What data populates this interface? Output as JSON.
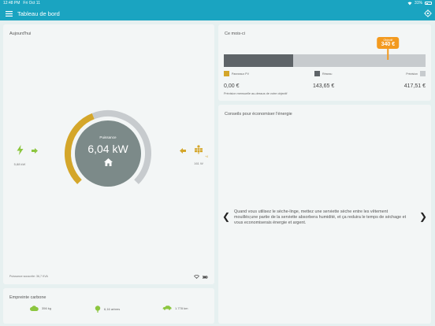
{
  "status_bar": {
    "time": "12:48 PM",
    "date": "Fri Oct 11",
    "battery": "31%",
    "battery_level": 0.31
  },
  "header": {
    "title": "Tableau de bord"
  },
  "today": {
    "title": "Aujourd'hui",
    "gauge_label": "Puissance",
    "gauge_value": "6,04 kW",
    "gauge_level": 0.42,
    "left_value": "5,88 kW",
    "right_value": "161 W",
    "right_badge": "+4",
    "footer": "Puissance souscrite: 36,7 KVA"
  },
  "month": {
    "title": "Ce mois-ci",
    "fill_fraction": 0.345,
    "objective_label": "Objectif",
    "objective_value": "340 €",
    "objective_fraction": 0.814,
    "legend": [
      {
        "label": "Panneaux PV",
        "color": "#d4a62a",
        "amount": "0,00 €"
      },
      {
        "label": "Réseau",
        "color": "#5e6468",
        "amount": "143,65 €"
      },
      {
        "label": "Prévision",
        "color": "#c7cbce",
        "amount": "417,51 €"
      }
    ],
    "note": "Prévision mensuelle au-dessus de votre objectif"
  },
  "tips": {
    "title": "Conseils pour économiser l'énergie",
    "text": "Quand vous utilisez le sèche-linge, mettez une serviette sèche entre les vêtement mouillés;une partie de la serviette absorbera humidité, et ça reduira le temps de séchage et vous economiserais énergie et argent.",
    "prev_arrow": "❮",
    "next_arrow": "❯"
  },
  "carbon": {
    "title": "Empreinte carbone",
    "items": [
      {
        "value": "356 kg",
        "icon": "cloud-icon"
      },
      {
        "value": "6,16 arbres",
        "icon": "tree-icon"
      },
      {
        "value": "1.778 km",
        "icon": "car-icon"
      }
    ]
  },
  "colors": {
    "accent": "#1aa4c1",
    "solar": "#d4a62a",
    "grid": "#5e6468",
    "forecast": "#c7cbce",
    "objective": "#f39a1f",
    "green": "#8cc63f"
  }
}
